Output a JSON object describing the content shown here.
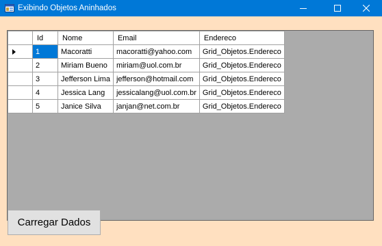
{
  "window": {
    "title": "Exibindo Objetos Aninhados",
    "icon": "windows-form-icon",
    "controls": [
      "minimize-icon",
      "maximize-icon",
      "close-icon"
    ],
    "titlebar_color": "#0078d7",
    "client_background": "#ffe0c0"
  },
  "grid": {
    "columns": [
      "Id",
      "Nome",
      "Email",
      "Endereco"
    ],
    "rows": [
      {
        "id": "1",
        "nome": "Macoratti",
        "email": "macoratti@yahoo.com",
        "endereco": "Grid_Objetos.Endereco"
      },
      {
        "id": "2",
        "nome": "Miriam Bueno",
        "email": "miriam@uol.com.br",
        "endereco": "Grid_Objetos.Endereco"
      },
      {
        "id": "3",
        "nome": "Jefferson Lima",
        "email": "jefferson@hotmail.com",
        "endereco": "Grid_Objetos.Endereco"
      },
      {
        "id": "4",
        "nome": "Jessica Lang",
        "email": "jessicalang@uol.com.br",
        "endereco": "Grid_Objetos.Endereco"
      },
      {
        "id": "5",
        "nome": "Janice Silva",
        "email": "janjan@net.com.br",
        "endereco": "Grid_Objetos.Endereco"
      }
    ],
    "current_row_indicator": "row-pointer-icon",
    "selected_cell": "row 1, Id",
    "selection_color": "#0078d7",
    "empty_area_color": "#ababab"
  },
  "button": {
    "label": "Carregar Dados"
  }
}
